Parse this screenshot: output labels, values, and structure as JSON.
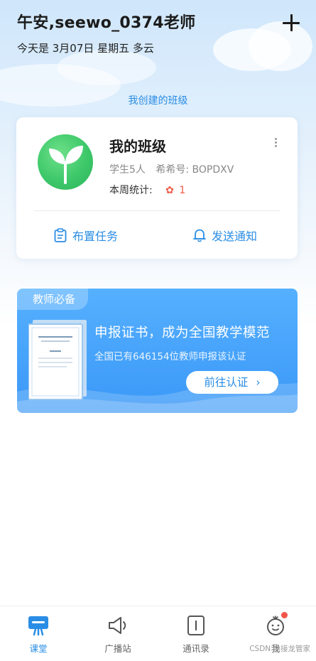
{
  "header": {
    "greeting": "午安,seewo_0374老师",
    "date_line": "今天是 3月07日 星期五 多云"
  },
  "section_title": "我创建的班级",
  "class_card": {
    "name": "我的班级",
    "students": "学生5人",
    "class_code": "希希号: BOPDXV",
    "week_stat_label": "本周统计:",
    "flower_count": "1",
    "actions": [
      {
        "label": "布置任务",
        "icon": "clipboard-icon"
      },
      {
        "label": "发送通知",
        "icon": "bell-icon"
      }
    ]
  },
  "banner": {
    "tag": "教师必备",
    "title": "申报证书，成为全国教学模范",
    "subtitle": "全国已有646154位教师申报该认证",
    "button": "前往认证"
  },
  "tabbar": {
    "tabs": [
      {
        "label": "课堂",
        "icon": "classroom-icon",
        "active": true
      },
      {
        "label": "广播站",
        "icon": "megaphone-icon"
      },
      {
        "label": "通讯录",
        "icon": "contacts-icon"
      },
      {
        "label": "我",
        "icon": "profile-icon",
        "badge": true
      }
    ]
  },
  "watermark": "CSDN @接龙管家",
  "colors": {
    "accent": "#2a8de5",
    "badge": "#f2544b",
    "flower": "#f05a45",
    "avatar_green": "#3dc86a"
  }
}
